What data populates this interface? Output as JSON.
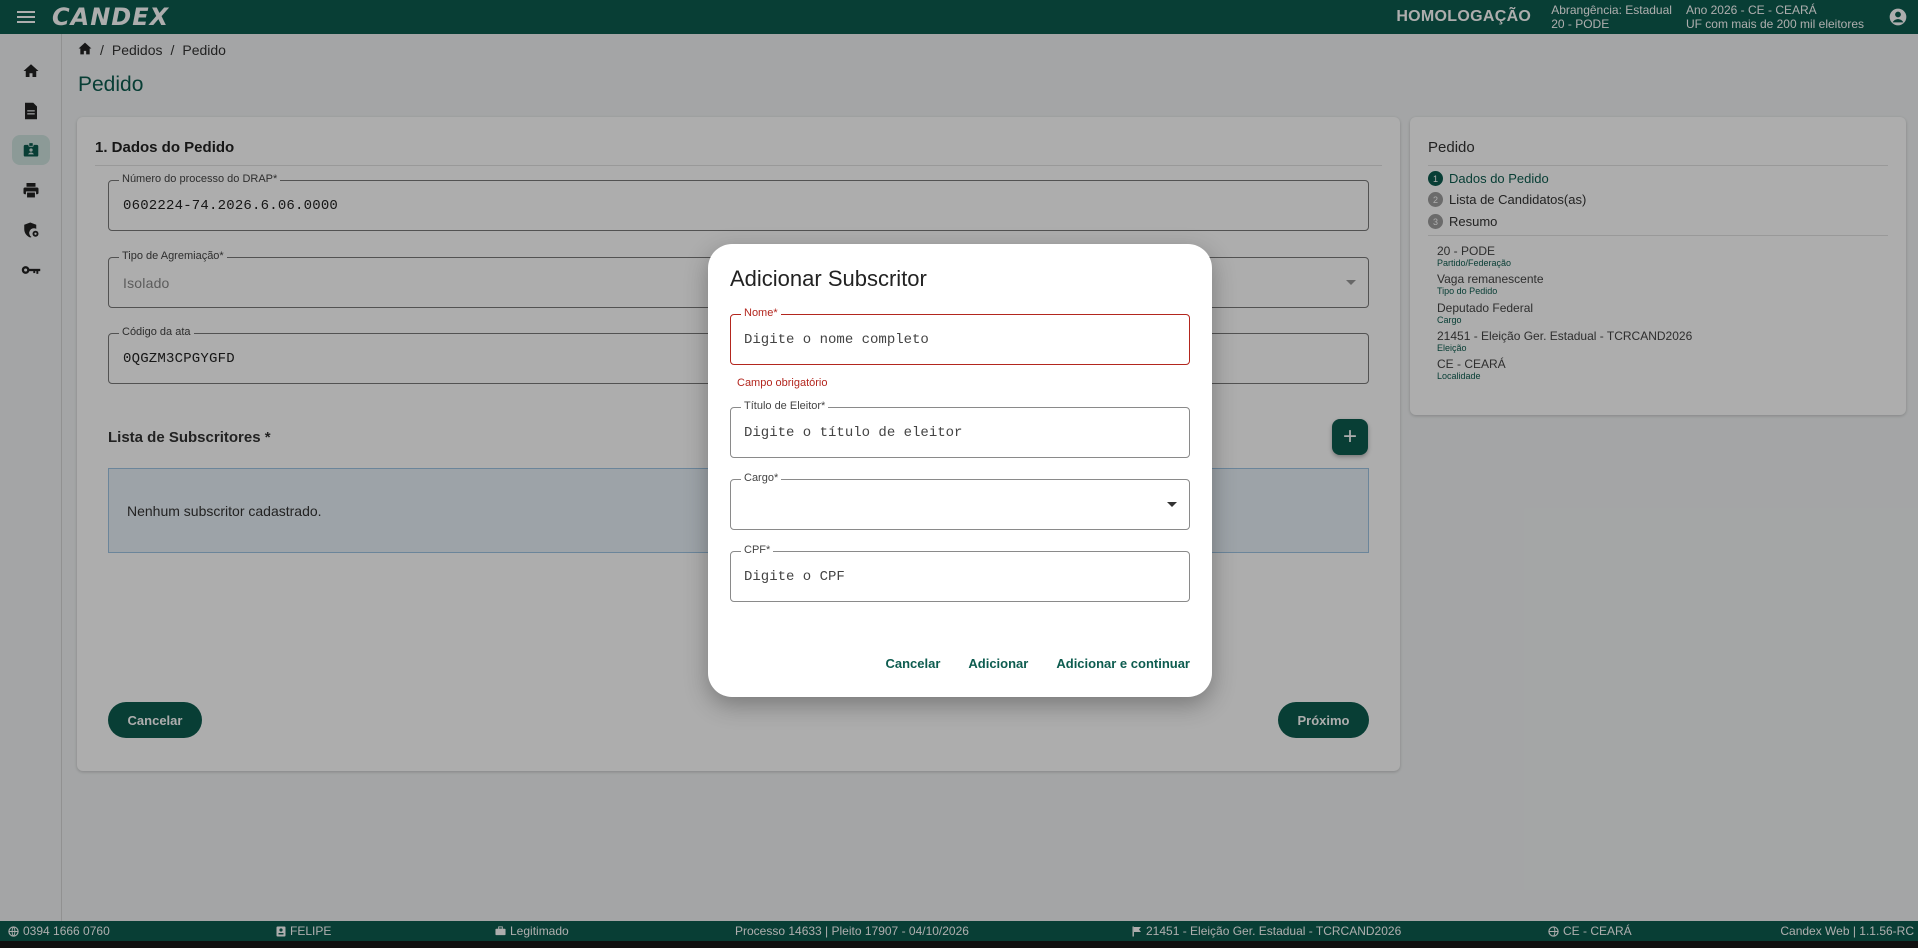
{
  "topbar": {
    "logo": "CANDEX",
    "environment": "HOMOLOGAÇÃO",
    "scope_line1": "Abrangência: Estadual",
    "scope_line2": "20 - PODE",
    "year_line1": "Ano 2026 - CE - CEARÁ",
    "year_line2": "UF com mais de 200 mil eleitores",
    "icons": [
      "menu-icon",
      "account-circle-icon"
    ]
  },
  "siderail": {
    "items": [
      {
        "icon": "home-icon"
      },
      {
        "icon": "document-icon"
      },
      {
        "icon": "badge-icon",
        "active": true
      },
      {
        "icon": "print-icon"
      },
      {
        "icon": "shield-settings-icon"
      },
      {
        "icon": "key-icon"
      }
    ]
  },
  "breadcrumb": {
    "items": [
      "Pedidos",
      "Pedido"
    ],
    "separator": "/"
  },
  "page": {
    "title": "Pedido"
  },
  "form": {
    "section_title": "1. Dados do Pedido",
    "drap": {
      "label": "Número do processo do DRAP*",
      "value": "0602224-74.2026.6.06.0000"
    },
    "agremiacao": {
      "label": "Tipo de Agremiação*",
      "value": "Isolado"
    },
    "ata": {
      "label": "Código da ata",
      "value": "0QGZM3CPGYGFD"
    },
    "subscritores_title": "Lista de Subscritores *",
    "add_icon": "+",
    "empty_message": "Nenhum subscritor cadastrado.",
    "cancel_label": "Cancelar",
    "next_label": "Próximo"
  },
  "summary_card": {
    "title": "Pedido",
    "steps": [
      {
        "num": "1",
        "label": "Dados do Pedido",
        "active": true
      },
      {
        "num": "2",
        "label": "Lista de Candidatos(as)",
        "active": false
      },
      {
        "num": "3",
        "label": "Resumo",
        "active": false
      }
    ],
    "details": [
      {
        "value": "20 - PODE",
        "label": "Partido/Federação"
      },
      {
        "value": "Vaga remanescente",
        "label": "Tipo do Pedido"
      },
      {
        "value": "Deputado Federal",
        "label": "Cargo"
      },
      {
        "value": "21451 - Eleição Ger. Estadual - TCRCAND2026",
        "label": "Eleição"
      },
      {
        "value": "CE - CEARÁ",
        "label": "Localidade"
      }
    ]
  },
  "dialog": {
    "title": "Adicionar Subscritor",
    "nome": {
      "label": "Nome*",
      "placeholder": "Digite o nome completo",
      "error": "Campo obrigatório"
    },
    "titulo": {
      "label": "Título de Eleitor*",
      "placeholder": "Digite o título de eleitor"
    },
    "cargo": {
      "label": "Cargo*",
      "value": ""
    },
    "cpf": {
      "label": "CPF*",
      "placeholder": "Digite o CPF"
    },
    "cancel_label": "Cancelar",
    "add_label": "Adicionar",
    "add_continue_label": "Adicionar e continuar"
  },
  "statusbar": {
    "phone": "0394 1666 0760",
    "user": "FELIPE",
    "status": "Legitimado",
    "process": "Processo 14633 | Pleito 17907 - 04/10/2026",
    "election": "21451 - Eleição Ger. Estadual - TCRCAND2026",
    "locality": "CE - CEARÁ",
    "version": "Candex Web | 1.1.56-RC"
  },
  "colors": {
    "primary": "#0d5c4f",
    "error": "#b3261e",
    "info_bg": "#e8f1f8",
    "info_border": "#9ec4e3"
  }
}
